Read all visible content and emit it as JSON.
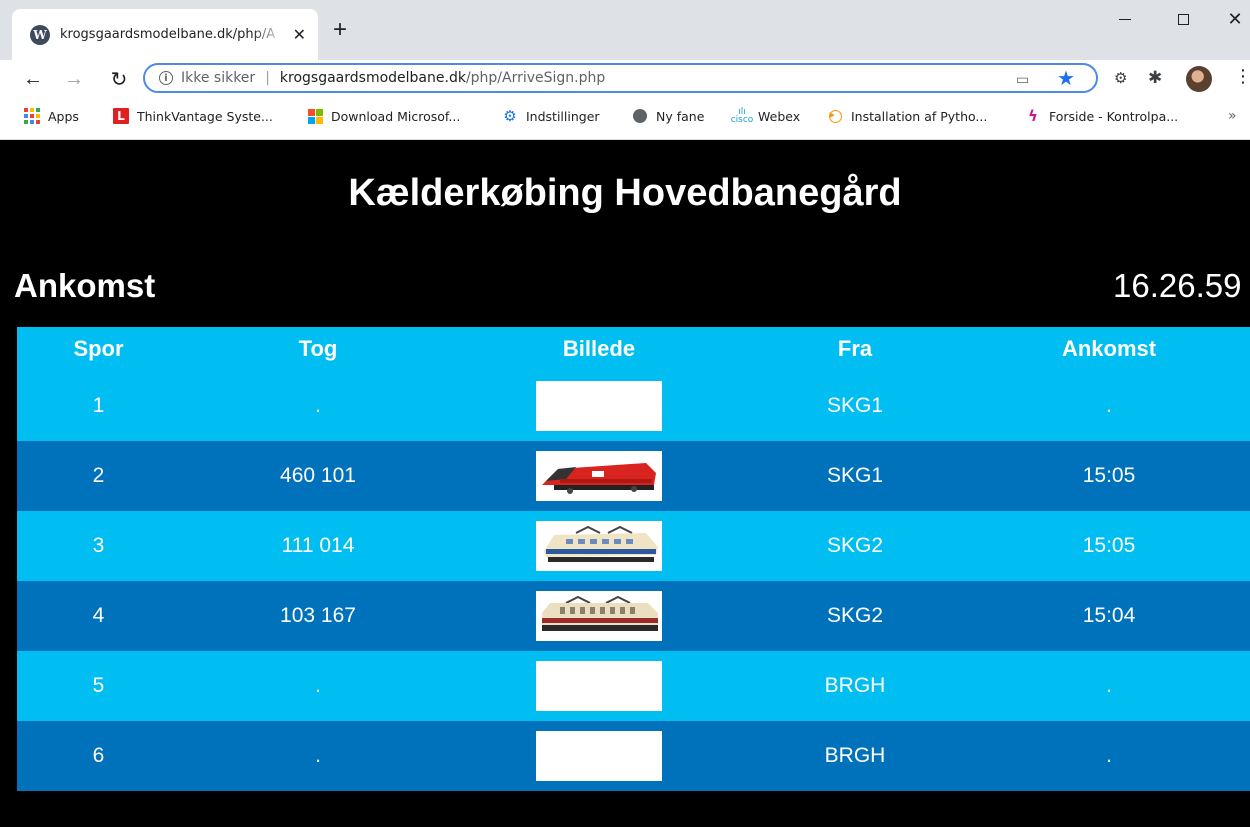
{
  "browser": {
    "tab_title": "krogsgaardsmodelbane.dk/php/A",
    "tab_icon": "wordpress-icon",
    "new_tab_label": "+",
    "security_label": "Ikke sikker",
    "url_host": "krogsgaardsmodelbane.dk",
    "url_path": "/php/ArriveSign.php",
    "bookmarks": [
      {
        "label": "Apps",
        "icon": "apps-grid-icon"
      },
      {
        "label": "ThinkVantage Syste...",
        "icon": "lenovo-icon"
      },
      {
        "label": "Download Microsof...",
        "icon": "microsoft-icon"
      },
      {
        "label": "Indstillinger",
        "icon": "gear-icon"
      },
      {
        "label": "Ny fane",
        "icon": "globe-icon"
      },
      {
        "label": "Webex",
        "icon": "cisco-icon"
      },
      {
        "label": "Installation af Pytho...",
        "icon": "play-icon"
      },
      {
        "label": "Forside - Kontrolpa...",
        "icon": "bolt-icon"
      }
    ]
  },
  "sign": {
    "title": "Kælderkøbing Hovedbanegård",
    "section": "Ankomst",
    "clock": "16.26.59",
    "headers": {
      "spor": "Spor",
      "tog": "Tog",
      "billede": "Billede",
      "fra": "Fra",
      "ankomst": "Ankomst"
    },
    "rows": [
      {
        "spor": "1",
        "tog": ".",
        "image": "blank",
        "fra": "SKG1",
        "ankomst": "."
      },
      {
        "spor": "2",
        "tog": "460 101",
        "image": "red-locomotive",
        "fra": "SKG1",
        "ankomst": "15:05"
      },
      {
        "spor": "3",
        "tog": "111 014",
        "image": "beige-blue-locomotive",
        "fra": "SKG2",
        "ankomst": "15:05"
      },
      {
        "spor": "4",
        "tog": "103 167",
        "image": "beige-red-locomotive",
        "fra": "SKG2",
        "ankomst": "15:04"
      },
      {
        "spor": "5",
        "tog": ".",
        "image": "blank",
        "fra": "BRGH",
        "ankomst": "."
      },
      {
        "spor": "6",
        "tog": ".",
        "image": "blank",
        "fra": "BRGH",
        "ankomst": "."
      }
    ]
  },
  "colors": {
    "row_light": "#00bef2",
    "row_dark": "#0072bc",
    "background": "#000000",
    "text": "#ffffff"
  }
}
